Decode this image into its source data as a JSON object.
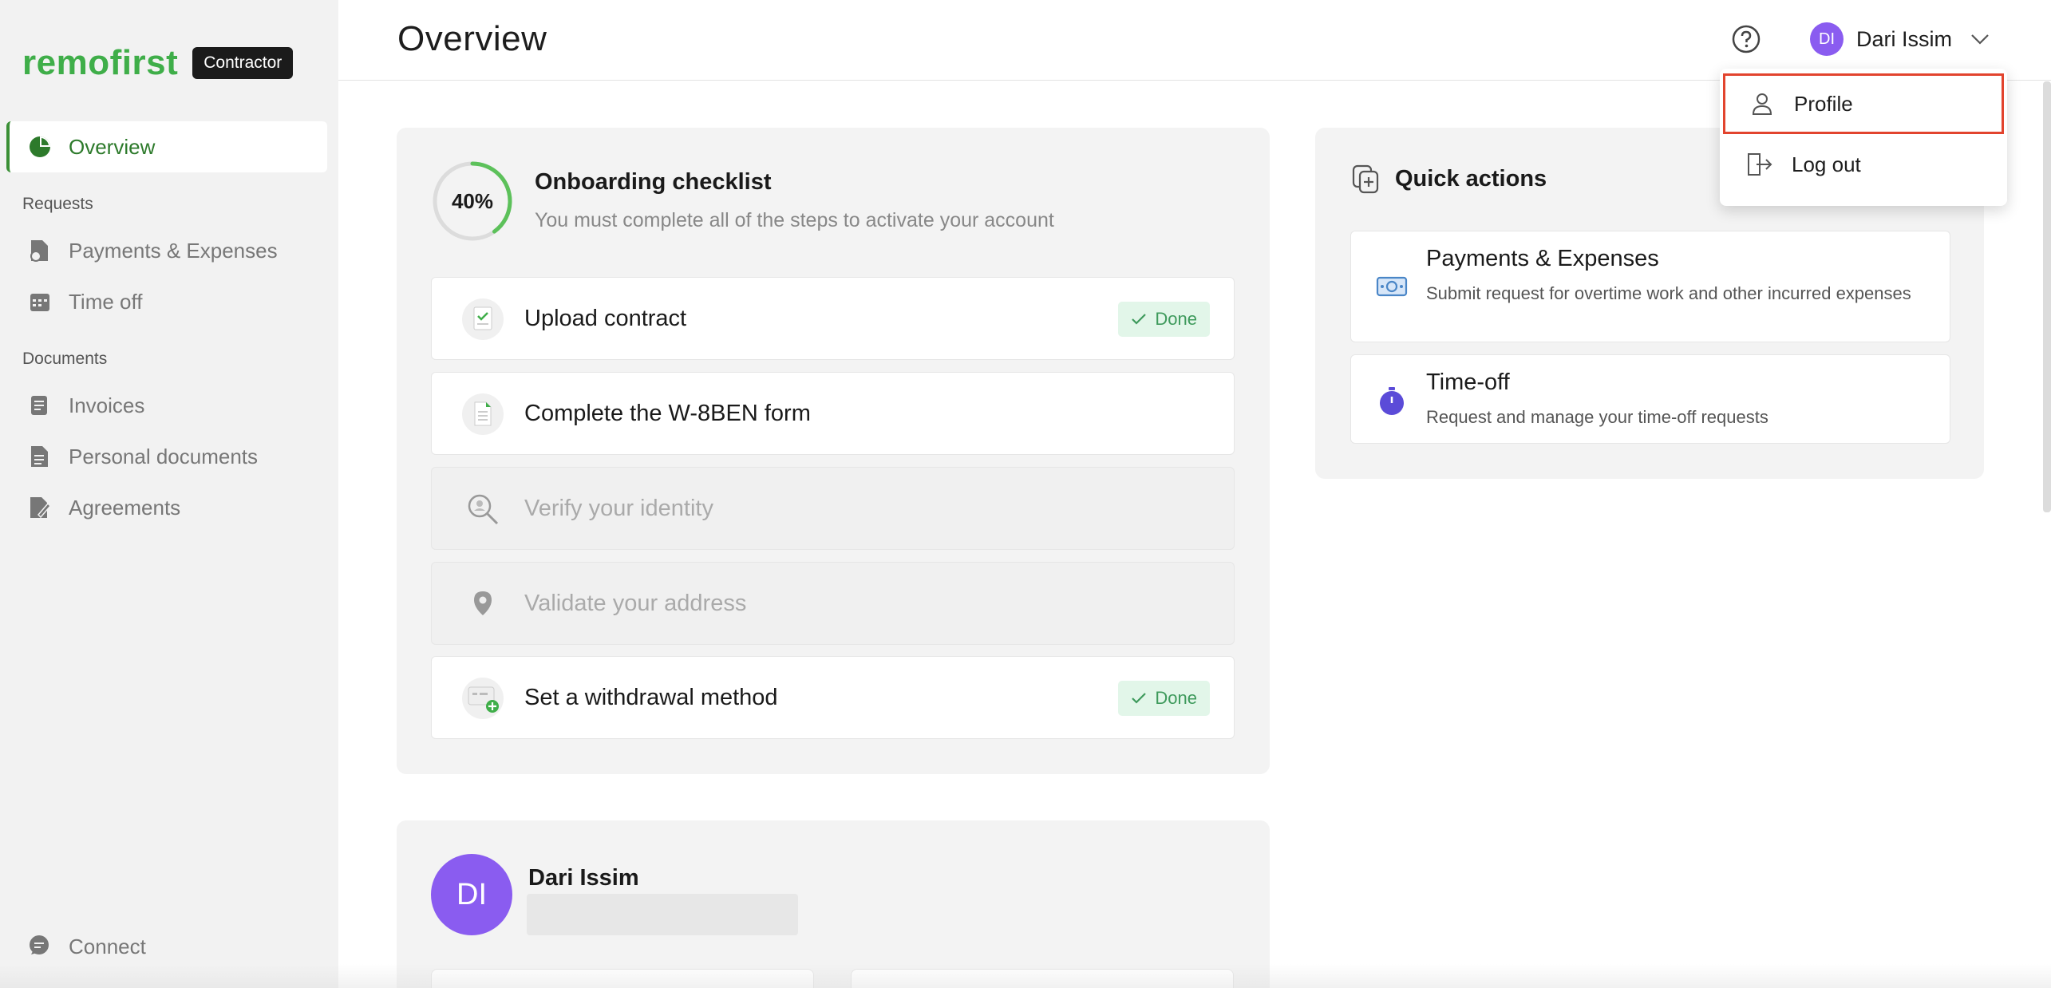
{
  "brand": {
    "logo": "remofirst",
    "badge": "Contractor"
  },
  "sidebar": {
    "overview": "Overview",
    "requests_title": "Requests",
    "requests": [
      {
        "label": "Payments & Expenses",
        "icon": "payments-icon"
      },
      {
        "label": "Time off",
        "icon": "calendar-icon"
      }
    ],
    "documents_title": "Documents",
    "documents": [
      {
        "label": "Invoices",
        "icon": "invoice-icon"
      },
      {
        "label": "Personal documents",
        "icon": "document-icon"
      },
      {
        "label": "Agreements",
        "icon": "agreement-icon"
      }
    ],
    "connect": "Connect"
  },
  "header": {
    "title": "Overview",
    "user_initials": "DI",
    "user_name": "Dari Issim"
  },
  "dropdown": {
    "profile": "Profile",
    "logout": "Log out"
  },
  "checklist": {
    "progress": "40%",
    "progress_fraction": 0.4,
    "title": "Onboarding checklist",
    "subtitle": "You must complete all of the steps to activate your account",
    "done_label": "Done",
    "steps": [
      {
        "label": "Upload contract",
        "status": "done"
      },
      {
        "label": "Complete the W-8BEN form",
        "status": "pending"
      },
      {
        "label": "Verify your identity",
        "status": "disabled"
      },
      {
        "label": "Validate your address",
        "status": "disabled"
      },
      {
        "label": "Set a withdrawal method",
        "status": "done"
      }
    ]
  },
  "quick_actions": {
    "title": "Quick actions",
    "items": [
      {
        "title": "Payments & Expenses",
        "desc": "Submit request for overtime work and other incurred expenses"
      },
      {
        "title": "Time-off",
        "desc": "Request and manage your time-off requests"
      }
    ]
  },
  "profile_card": {
    "initials": "DI",
    "name": "Dari Issim"
  },
  "colors": {
    "brand_green": "#3fae49",
    "avatar_purple": "#8a5cf0",
    "done_green": "#3e9a5c",
    "highlight_red": "#e2442e"
  }
}
